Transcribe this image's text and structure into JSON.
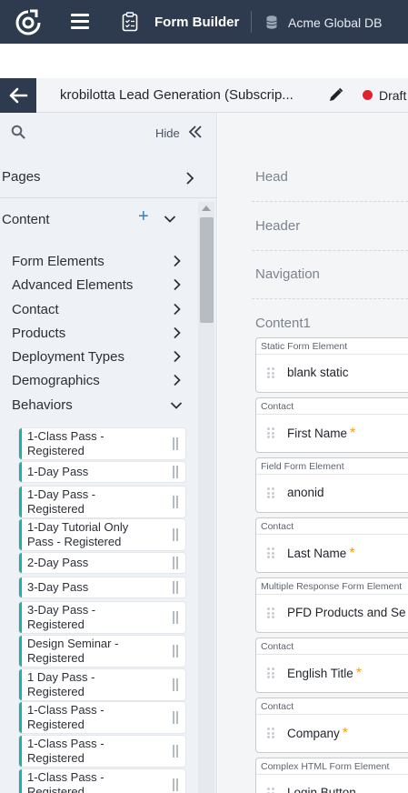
{
  "topbar": {
    "app_title": "Form Builder",
    "database": "Acme Global DB",
    "icons": [
      "logo-icon",
      "menu-icon",
      "clipboard-icon",
      "database-icon"
    ]
  },
  "titlebar": {
    "form_title": "krobilotta Lead Generation (Subscrip...",
    "status": "Draft",
    "status_color": "#e2202e",
    "icons": [
      "back-arrow-icon",
      "pencil-icon"
    ]
  },
  "sidebar": {
    "hide_label": "Hide",
    "pages_label": "Pages",
    "content_label": "Content",
    "add_symbol": "+",
    "categories": [
      {
        "label": "Form Elements",
        "expanded": false
      },
      {
        "label": "Advanced Elements",
        "expanded": false
      },
      {
        "label": "Contact",
        "expanded": false
      },
      {
        "label": "Products",
        "expanded": false
      },
      {
        "label": "Deployment Types",
        "expanded": false
      },
      {
        "label": "Demographics",
        "expanded": false
      },
      {
        "label": "Behaviors",
        "expanded": true
      }
    ],
    "behaviors": [
      {
        "line1": "1-Class Pass -",
        "line2": "Registered"
      },
      {
        "line1": "1-Day Pass",
        "line2": ""
      },
      {
        "line1": "1-Day Pass -",
        "line2": "Registered"
      },
      {
        "line1": "1-Day Tutorial Only",
        "line2": "Pass - Registered"
      },
      {
        "line1": "2-Day Pass",
        "line2": ""
      },
      {
        "line1": "3-Day Pass",
        "line2": ""
      },
      {
        "line1": "3-Day Pass -",
        "line2": "Registered"
      },
      {
        "line1": "Design Seminar -",
        "line2": "Registered"
      },
      {
        "line1": "1 Day Pass -",
        "line2": "Registered"
      },
      {
        "line1": "1-Class Pass -",
        "line2": "Registered"
      },
      {
        "line1": "1-Class Pass -",
        "line2": "Registered"
      },
      {
        "line1": "1-Class Pass -",
        "line2": "Registered"
      }
    ],
    "accent_color": "#19b3a5"
  },
  "canvas": {
    "sections": [
      "Head",
      "Header",
      "Navigation",
      "Content1"
    ],
    "required_marker": "*",
    "required_color": "#f2a01c",
    "elements": [
      {
        "type": "Static Form Element",
        "name": "blank static",
        "required": false
      },
      {
        "type": "Contact",
        "name": "First Name",
        "required": true
      },
      {
        "type": "Field Form Element",
        "name": "anonid",
        "required": false
      },
      {
        "type": "Contact",
        "name": "Last Name",
        "required": true
      },
      {
        "type": "Multiple Response Form Element",
        "name": "PFD Products and Se",
        "required": false
      },
      {
        "type": "Contact",
        "name": "English Title",
        "required": true
      },
      {
        "type": "Contact",
        "name": "Company",
        "required": true
      },
      {
        "type": "Complex HTML Form Element",
        "name": "Login Button",
        "required": false
      }
    ]
  }
}
